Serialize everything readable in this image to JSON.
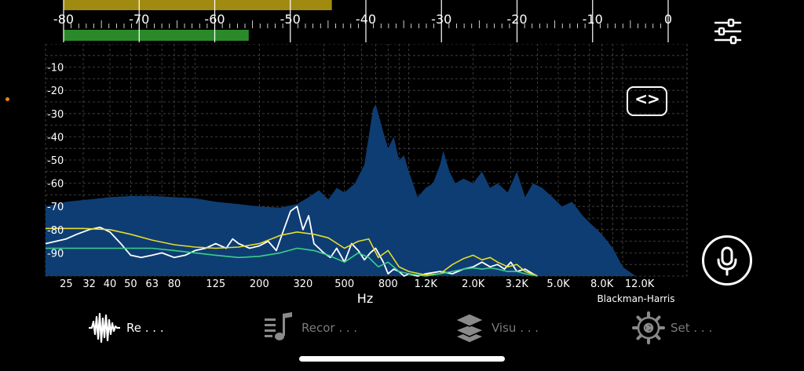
{
  "colors": {
    "background": "#000000",
    "meter_bar_top": "#a08a10",
    "meter_bar_bottom": "#2a8a2a",
    "spectrum_fill": "#0e3d73",
    "peak_line": "#ffffff",
    "yellow_curve": "#e6dc2a",
    "green_curve": "#3ccf8a",
    "grid": "#4a4a4a"
  },
  "level_meter": {
    "ticks": [
      "-80",
      "-70",
      "-60",
      "-50",
      "-40",
      "-30",
      "-20",
      "-10",
      "0"
    ],
    "tick_values": [
      -80,
      -70,
      -60,
      -50,
      -40,
      -30,
      -20,
      -10,
      0
    ],
    "peak_level_db": -44.5,
    "rms_level_db": -55.5
  },
  "chart_data": {
    "type": "area",
    "xlabel": "Hz",
    "x_tick_labels": [
      "25",
      "32",
      "40",
      "50",
      "63",
      "80",
      "125",
      "200",
      "320",
      "500",
      "800",
      "1.2K",
      "2.0K",
      "3.2K",
      "5.0K",
      "8.0K",
      "12.0K"
    ],
    "x_tick_values": [
      25,
      32,
      40,
      50,
      63,
      80,
      125,
      200,
      320,
      500,
      800,
      1200,
      2000,
      3200,
      5000,
      8000,
      12000
    ],
    "y_tick_labels": [
      "-10",
      "-20",
      "-30",
      "-40",
      "-50",
      "-60",
      "-70",
      "-80",
      "-90"
    ],
    "y_tick_values": [
      -10,
      -20,
      -30,
      -40,
      -50,
      -60,
      -70,
      -80,
      -90
    ],
    "ylim": [
      -100,
      0
    ],
    "x_scale": "log",
    "grid": true,
    "window_function": "Blackman-Harris",
    "series": [
      {
        "style": "filled-spectrum",
        "x": [
          20,
          25,
          32,
          40,
          50,
          63,
          80,
          100,
          125,
          160,
          200,
          250,
          300,
          340,
          380,
          420,
          460,
          500,
          560,
          620,
          680,
          700,
          720,
          760,
          800,
          850,
          900,
          950,
          1000,
          1100,
          1200,
          1300,
          1400,
          1450,
          1550,
          1650,
          1800,
          2000,
          2200,
          2400,
          2600,
          2900,
          3200,
          3500,
          3800,
          4200,
          4700,
          5200,
          5800,
          6500,
          7200,
          8000,
          9000,
          10000,
          11500,
          13000,
          15000,
          17000,
          19000,
          20000
        ],
        "y": [
          -70,
          -68,
          -67,
          -66,
          -65.5,
          -65.5,
          -66,
          -66.5,
          -68,
          -69,
          -70,
          -70.5,
          -69,
          -66,
          -63,
          -67,
          -62,
          -64,
          -60,
          -52,
          -28,
          -26,
          -30,
          -38,
          -45,
          -40,
          -50,
          -48,
          -55,
          -66,
          -62,
          -60,
          -52,
          -46,
          -55,
          -60,
          -58,
          -60,
          -55,
          -62,
          -60,
          -64,
          -55,
          -66,
          -60,
          -62,
          -66,
          -70,
          -68,
          -74,
          -78,
          -82,
          -88,
          -96,
          -100,
          -100,
          -100,
          -100,
          -100,
          -100
        ]
      },
      {
        "style": "peak-line",
        "x": [
          20,
          25,
          28,
          32,
          36,
          40,
          45,
          50,
          56,
          63,
          70,
          80,
          90,
          100,
          112,
          125,
          140,
          150,
          160,
          180,
          200,
          220,
          240,
          260,
          280,
          300,
          320,
          340,
          360,
          380,
          400,
          430,
          460,
          500,
          540,
          580,
          620,
          660,
          700,
          760,
          800,
          850,
          900,
          950,
          1000,
          1100,
          1200,
          1400,
          1600,
          1800,
          2000,
          2200,
          2400,
          2600,
          2800,
          3000,
          3200,
          3500,
          3800,
          4000
        ],
        "y": [
          -86,
          -84,
          -82,
          -80,
          -79,
          -81,
          -86,
          -91,
          -92,
          -91,
          -90,
          -92,
          -91,
          -89,
          -88,
          -86,
          -88,
          -84,
          -86,
          -88,
          -87,
          -85,
          -89,
          -80,
          -72,
          -70,
          -80,
          -74,
          -86,
          -88,
          -90,
          -92,
          -88,
          -94,
          -86,
          -89,
          -93,
          -90,
          -88,
          -94,
          -99,
          -97,
          -98,
          -100,
          -99,
          -100,
          -99,
          -98,
          -99,
          -97,
          -96,
          -94,
          -96,
          -95,
          -97,
          -94,
          -98,
          -97,
          -99,
          -100
        ]
      },
      {
        "style": "smoothed-line",
        "color_key": "yellow_curve",
        "x": [
          20,
          30,
          40,
          50,
          63,
          80,
          100,
          125,
          160,
          200,
          250,
          300,
          360,
          420,
          500,
          580,
          650,
          720,
          800,
          900,
          1000,
          1200,
          1400,
          1600,
          1800,
          2000,
          2200,
          2400,
          2600,
          2900,
          3200,
          3500,
          4000
        ],
        "y": [
          -79.5,
          -79.5,
          -80,
          -82,
          -84.5,
          -86.5,
          -87.5,
          -88,
          -87.5,
          -86,
          -82.5,
          -81,
          -82,
          -83.5,
          -88,
          -85,
          -84,
          -92,
          -89,
          -96,
          -98,
          -99.5,
          -99,
          -95,
          -92.5,
          -91,
          -93,
          -92,
          -94,
          -96,
          -95,
          -98,
          -100
        ]
      },
      {
        "style": "smoothed-line",
        "color_key": "green_curve",
        "x": [
          20,
          30,
          40,
          50,
          63,
          80,
          100,
          125,
          160,
          200,
          250,
          300,
          360,
          420,
          500,
          580,
          650,
          720,
          800,
          900,
          1000,
          1200,
          1400,
          1600,
          1800,
          2000,
          2200,
          2400,
          2600,
          2900,
          3200,
          3500,
          4000
        ],
        "y": [
          -88,
          -88,
          -88,
          -88,
          -88,
          -89,
          -90,
          -91,
          -92,
          -91.5,
          -90,
          -88,
          -89,
          -91,
          -94,
          -90,
          -92,
          -96,
          -94,
          -98,
          -99,
          -100,
          -99,
          -98,
          -97,
          -96.5,
          -97,
          -96.5,
          -97,
          -98,
          -98,
          -99,
          -100
        ]
      }
    ]
  },
  "buttons": {
    "code_toggle_glyph": "<>"
  },
  "tabs": [
    {
      "label": "Re . . .",
      "icon": "waveform-icon",
      "active": true
    },
    {
      "label": "Recor . . .",
      "icon": "music-list-icon",
      "active": false
    },
    {
      "label": "Visu . . .",
      "icon": "layers-icon",
      "active": false
    },
    {
      "label": "Set . . .",
      "icon": "gear-icon",
      "active": false
    }
  ]
}
